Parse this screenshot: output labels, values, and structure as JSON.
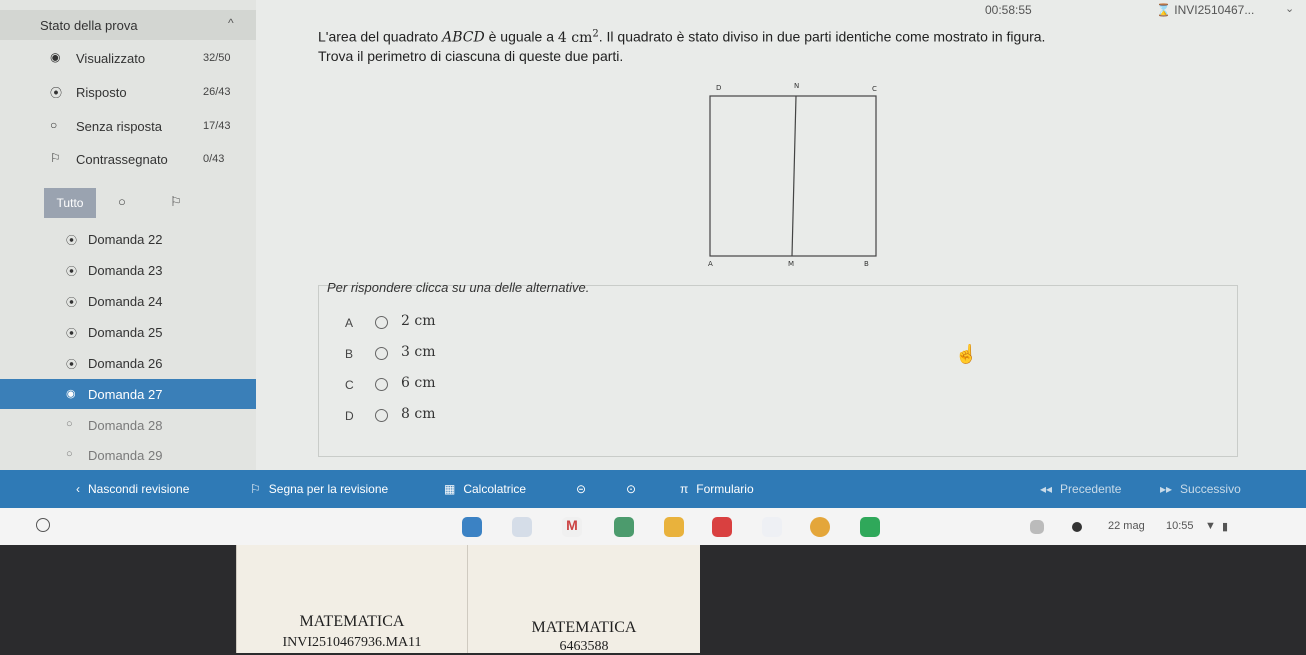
{
  "header": {
    "timer": "00:58:55",
    "user": "INVI2510467..."
  },
  "sidebar": {
    "title": "Stato della prova",
    "stats": [
      {
        "label": "Visualizzato",
        "count": "32/50"
      },
      {
        "label": "Risposto",
        "count": "26/43"
      },
      {
        "label": "Senza risposta",
        "count": "17/43"
      },
      {
        "label": "Contrassegnato",
        "count": "0/43"
      }
    ],
    "filter_all": "Tutto",
    "questions": [
      {
        "label": "Domanda 22"
      },
      {
        "label": "Domanda 23"
      },
      {
        "label": "Domanda 24"
      },
      {
        "label": "Domanda 25"
      },
      {
        "label": "Domanda 26"
      },
      {
        "label": "Domanda 27"
      },
      {
        "label": "Domanda 28"
      },
      {
        "label": "Domanda 29"
      }
    ]
  },
  "question": {
    "part1": "L'area del quadrato ",
    "square": "ABCD",
    "part2": " è uguale a ",
    "area_value": "4 cm",
    "area_exp": "2",
    "part3": ". Il quadrato è stato diviso in due parti identiche come mostrato in figura.",
    "line2": "Trova il perimetro di ciascuna di queste due parti."
  },
  "figure": {
    "d": "D",
    "n": "N",
    "c": "C",
    "a": "A",
    "m": "M",
    "b": "B"
  },
  "answers": {
    "hint": "Per rispondere clicca su una delle alternative.",
    "options": [
      {
        "letter": "A",
        "value": "2 cm"
      },
      {
        "letter": "B",
        "value": "3 cm"
      },
      {
        "letter": "C",
        "value": "6 cm"
      },
      {
        "letter": "D",
        "value": "8 cm"
      }
    ]
  },
  "toolbar": {
    "hide_review": "Nascondi revisione",
    "flag_review": "Segna per la revisione",
    "calculator": "Calcolatrice",
    "formulary": "Formulario",
    "prev": "Precedente",
    "next": "Successivo"
  },
  "taskbar": {
    "date": "22 mag",
    "time": "10:55"
  },
  "stickers": [
    {
      "line1": "MATEMATICA",
      "line2": "INVI2510467936.MA11"
    },
    {
      "line1": "MATEMATICA",
      "line2": "6463588"
    }
  ],
  "colors": {
    "accent": "#2f7ab6",
    "active_row": "#3a7fb8",
    "background": "#e9ebe9"
  }
}
